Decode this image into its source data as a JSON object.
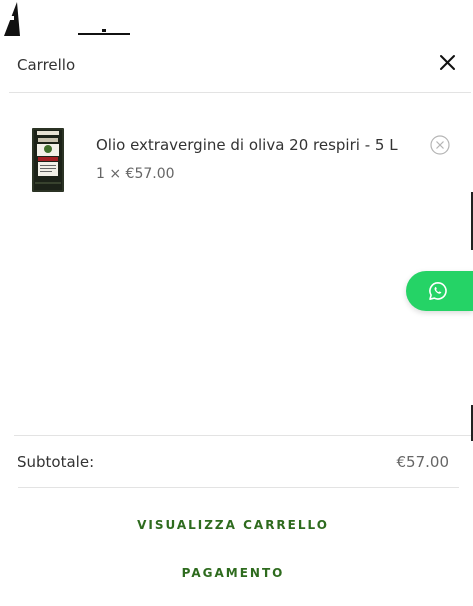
{
  "cart": {
    "title": "Carrello",
    "close_icon": "close-icon",
    "items": [
      {
        "name": "Olio extravergine di oliva 20 respiri - 5 L",
        "quantity_price": "1 × €57.00",
        "remove_icon": "remove-circle-x-icon"
      }
    ],
    "subtotal_label": "Subtotale:",
    "subtotal_value": "€57.00",
    "view_cart_label": "VISUALIZZA CARRELLO",
    "checkout_label": "PAGAMENTO"
  },
  "whatsapp": {
    "icon": "whatsapp-icon",
    "color": "#25d366"
  },
  "colors": {
    "accent_link": "#2e6b1e",
    "divider": "#e3e3e3",
    "text": "#333333"
  }
}
